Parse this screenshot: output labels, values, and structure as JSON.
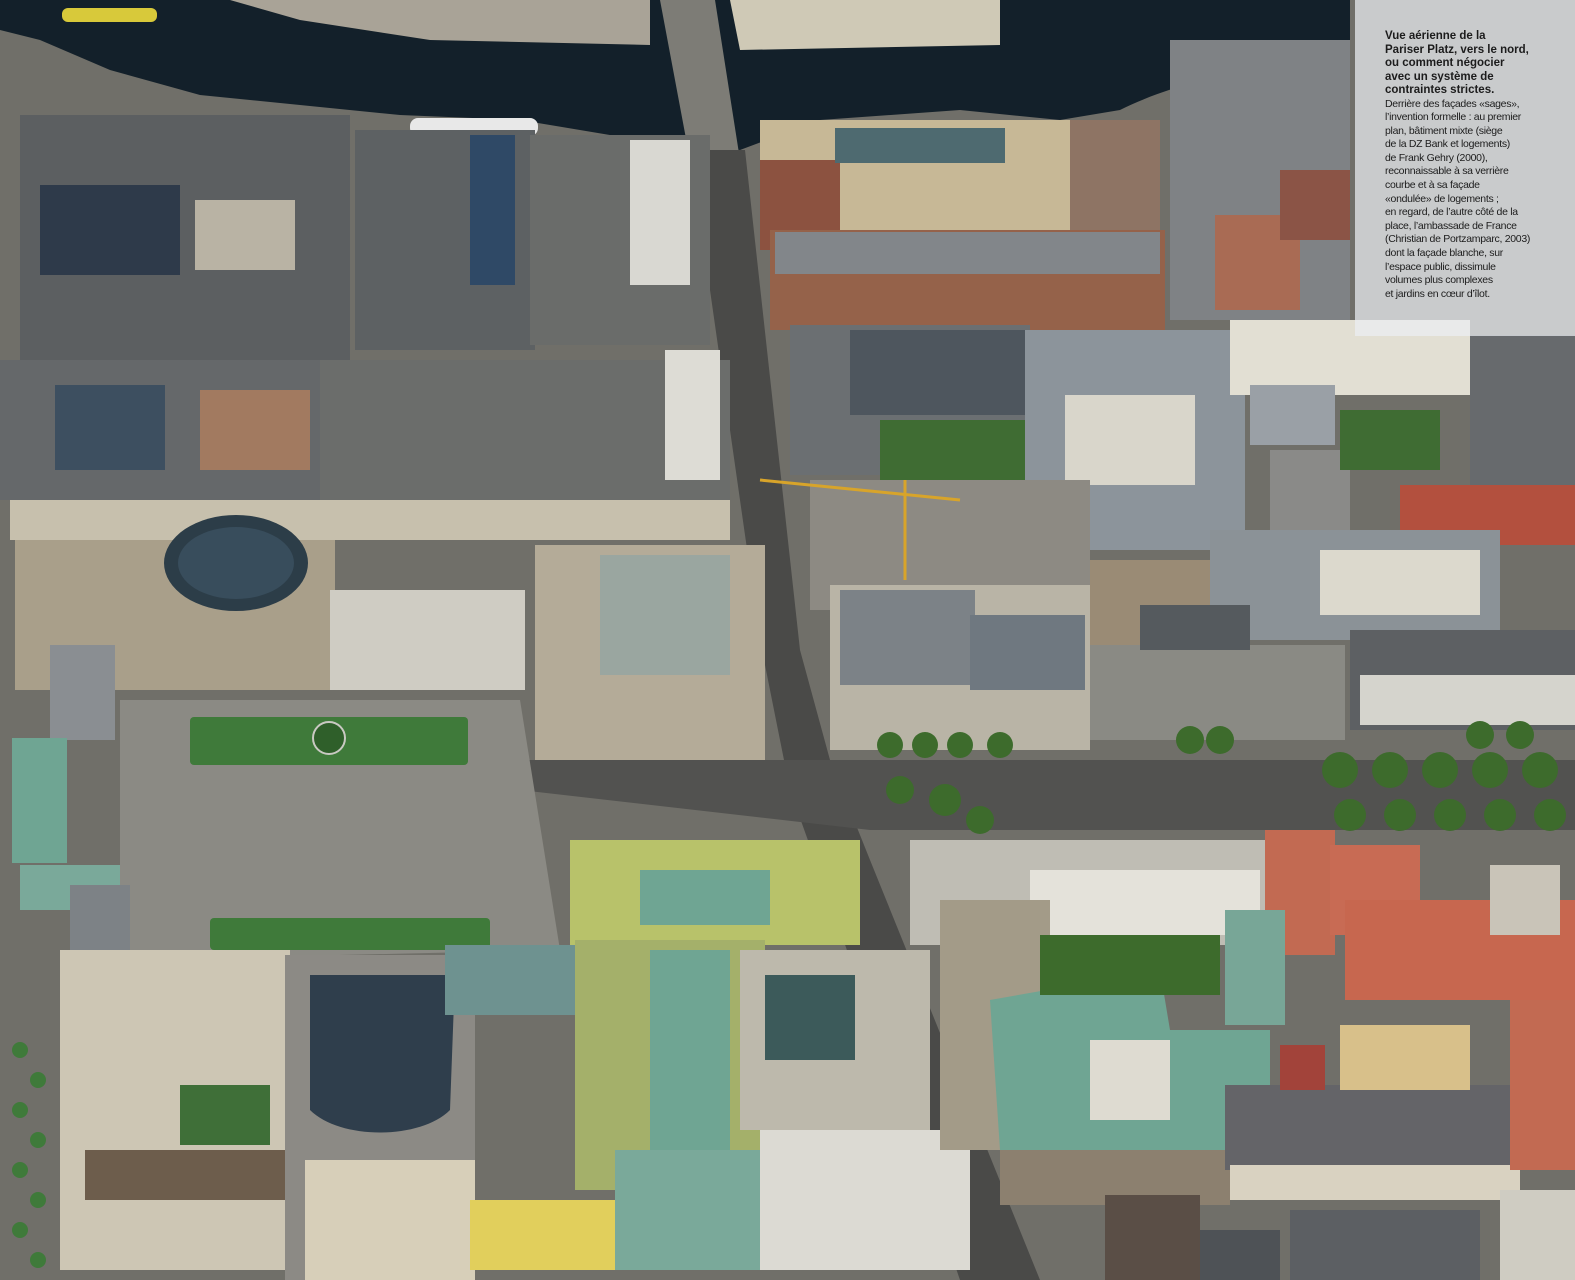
{
  "caption": {
    "title_lines": [
      "Vue aérienne de la",
      "Pariser Platz, vers le nord,",
      "ou comment négocier",
      "avec un système de",
      "contraintes strictes."
    ],
    "body_lines": [
      "Derrière des façades «sages»,",
      "l’invention formelle : au premier",
      "plan, bâtiment mixte (siège",
      "de la DZ Bank et logements)",
      "de Frank Gehry (2000),",
      "reconnaissable à sa verrière",
      "courbe et à sa façade",
      "«ondulée» de logements ;",
      "en regard, de l’autre côté de la",
      "place, l’ambassade de France",
      "(Christian de Portzamparc, 2003)",
      "dont la façade blanche, sur",
      "l’espace public, dissimule",
      "volumes plus complexes",
      "et jardins en cœur d’îlot."
    ]
  },
  "colors": {
    "river": "#13202a",
    "street": "#4a4a48",
    "plaza": "#8b8a84",
    "green_roof": "#6fa593",
    "grass": "#3f7a3a",
    "trees": "#3d6b2c"
  }
}
